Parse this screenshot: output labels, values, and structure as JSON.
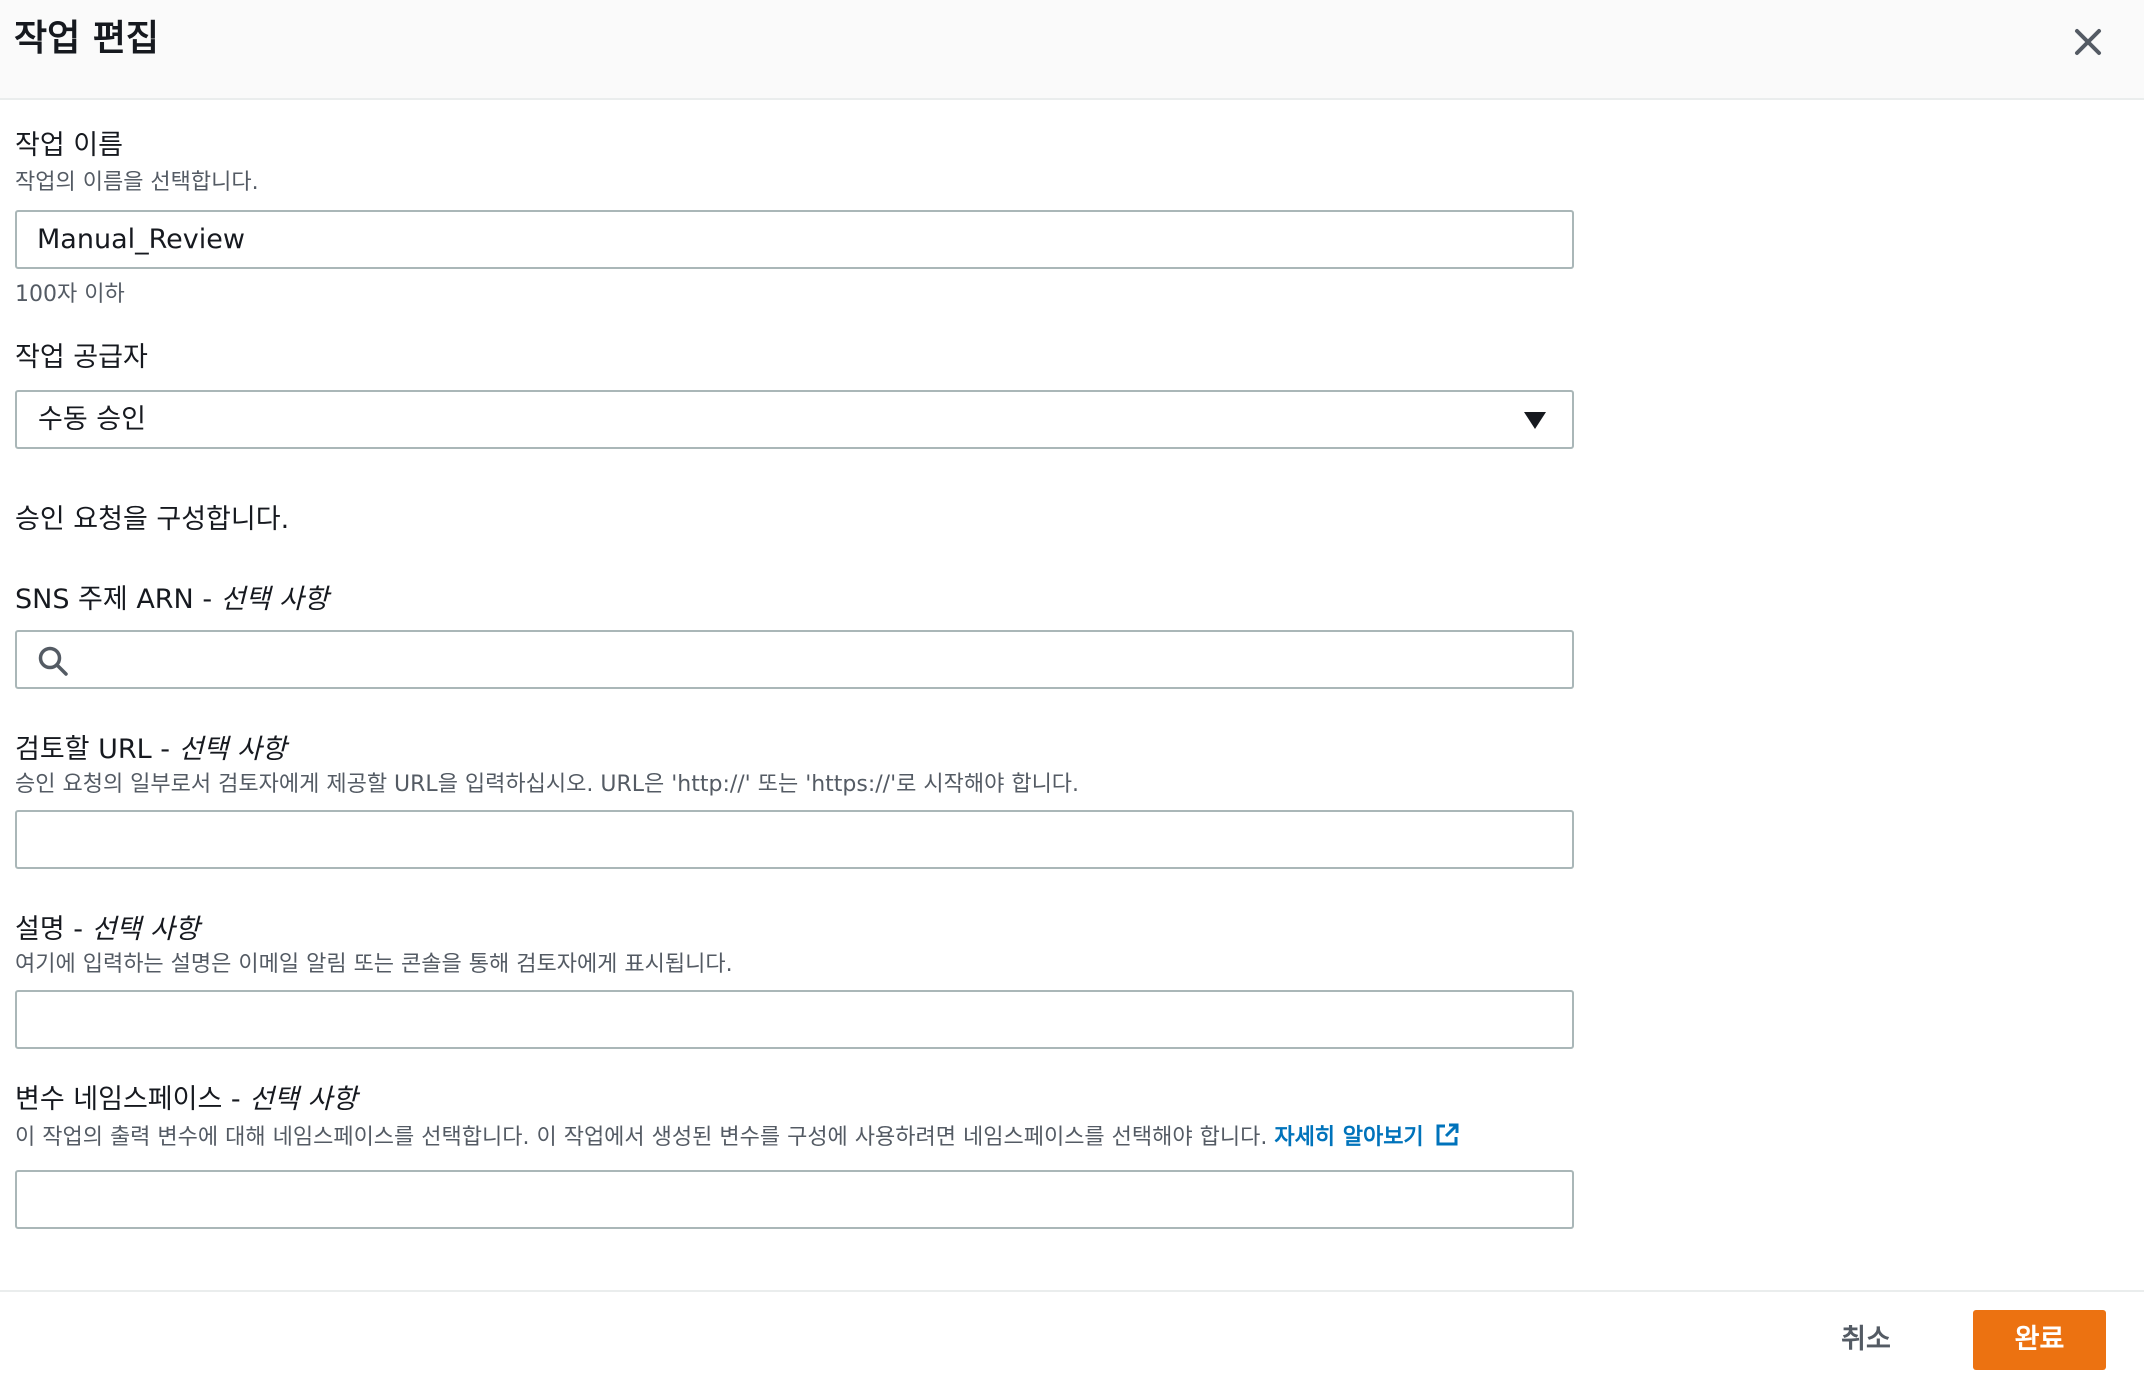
{
  "header": {
    "title": "작업 편집",
    "close_icon": "close-icon"
  },
  "fields": {
    "action_name": {
      "label": "작업 이름",
      "description": "작업의 이름을 선택합니다.",
      "value": "Manual_Review",
      "constraint": "100자 이하"
    },
    "action_provider": {
      "label": "작업 공급자",
      "selected": "수동 승인"
    },
    "approval_text": "승인 요청을 구성합니다.",
    "sns_topic": {
      "label": "SNS 주제 ARN - ",
      "optional": "선택 사항",
      "value": ""
    },
    "review_url": {
      "label": "검토할 URL - ",
      "optional": "선택 사항",
      "description": "승인 요청의 일부로서 검토자에게 제공할 URL을 입력하십시오. URL은 'http://' 또는 'https://'로 시작해야 합니다.",
      "value": ""
    },
    "comments": {
      "label": "설명 - ",
      "optional": "선택 사항",
      "description": "여기에 입력하는 설명은 이메일 알림 또는 콘솔을 통해 검토자에게 표시됩니다.",
      "value": ""
    },
    "variable_namespace": {
      "label": "변수 네임스페이스 - ",
      "optional": "선택 사항",
      "description": "이 작업의 출력 변수에 대해 네임스페이스를 선택합니다. 이 작업에서 생성된 변수를 구성에 사용하려면 네임스페이스를 선택해야 합니다. ",
      "link": "자세히 알아보기",
      "value": ""
    }
  },
  "footer": {
    "cancel_label": "취소",
    "done_label": "완료"
  },
  "colors": {
    "primary": "#ec7211",
    "link": "#0073bb",
    "border": "#aab7b8",
    "header_bg": "#fafafa"
  }
}
